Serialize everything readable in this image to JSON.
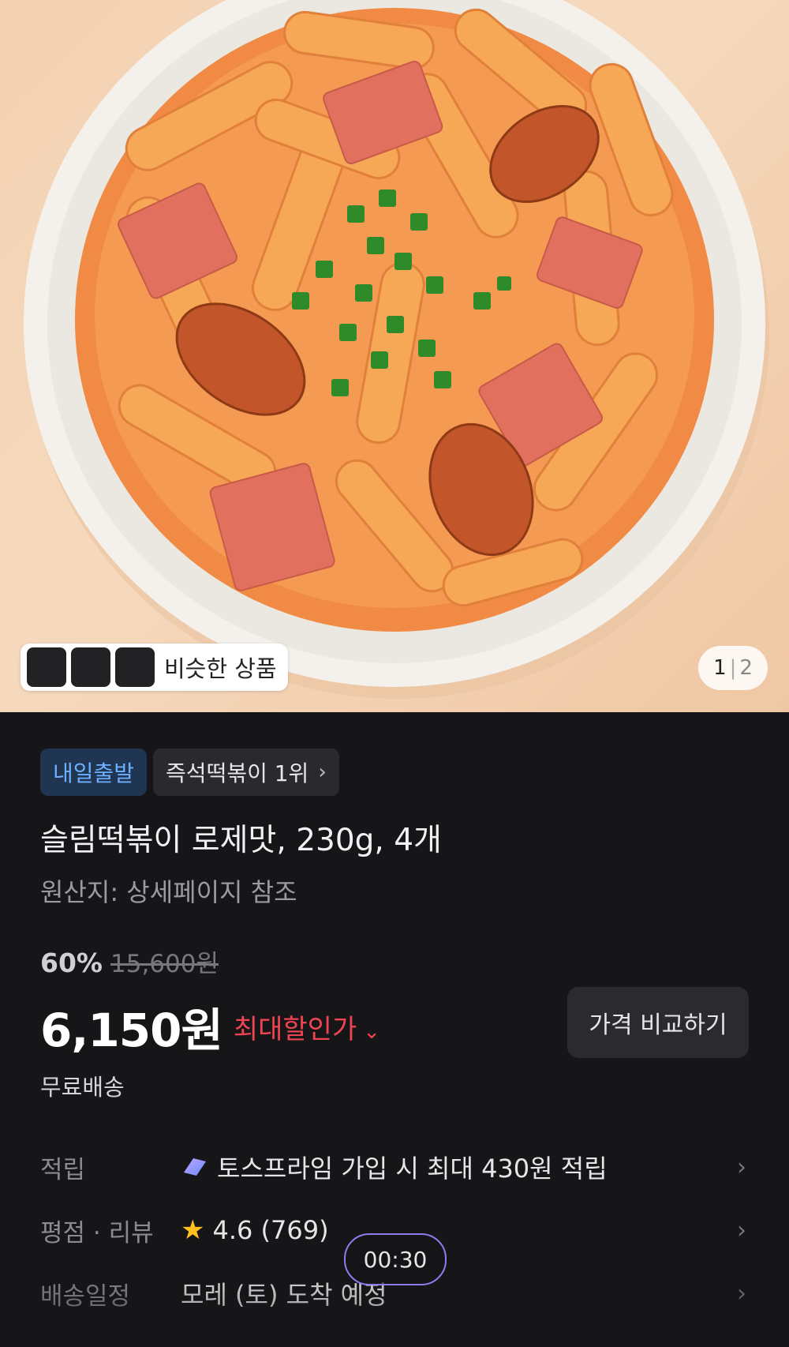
{
  "hero": {
    "similar_label": "비슷한 상품",
    "page_current": "1",
    "page_separator": "|",
    "page_total": "2"
  },
  "badges": {
    "delivery": "내일출발",
    "ranking": "즉석떡볶이 1위"
  },
  "product": {
    "title": "슬림떡볶이 로제맛, 230g, 4개",
    "origin": "원산지: 상세페이지 참조",
    "discount_rate": "60%",
    "original_price": "15,600원",
    "price": "6,150원",
    "max_discount_label": "최대할인가",
    "compare_button": "가격 비교하기",
    "shipping": "무료배송"
  },
  "info": [
    {
      "key": "적립",
      "value": "토스프라임 가입 시 최대 430원 적립",
      "icon": "prime-icon"
    },
    {
      "key": "평점 · 리뷰",
      "value": "4.6 (769)",
      "icon": "star-icon"
    },
    {
      "key": "배송일정",
      "value": "모레 (토) 도착 예정",
      "icon": ""
    }
  ],
  "timer": "00:30",
  "colors": {
    "accent_red": "#ef4452",
    "accent_blue": "#6db0ff",
    "star": "#ffbf1f",
    "timer_border": "#8f7cf0"
  }
}
